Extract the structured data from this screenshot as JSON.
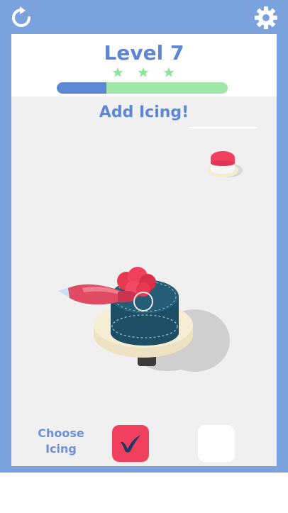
{
  "header": {
    "level_title": "Level 7",
    "stars": 3,
    "progress": 0.29
  },
  "game": {
    "instruction": "Add Icing!"
  },
  "icing_picker": {
    "label_line1": "Choose",
    "label_line2": "Icing",
    "options": [
      {
        "name": "red",
        "color": "#f0405e",
        "selected": true
      },
      {
        "name": "white",
        "color": "#ffffff",
        "selected": false
      }
    ]
  },
  "icons": {
    "restart": "restart-icon",
    "settings": "gear-icon",
    "star": "star-icon",
    "check": "check-icon"
  },
  "colors": {
    "frame": "#7aa3de",
    "accent_blue": "#5b87d6",
    "progress_green": "#9fe6a8",
    "cake_body": "#1d4e63",
    "icing_red": "#f0405e",
    "plate": "#f4ecd0"
  }
}
